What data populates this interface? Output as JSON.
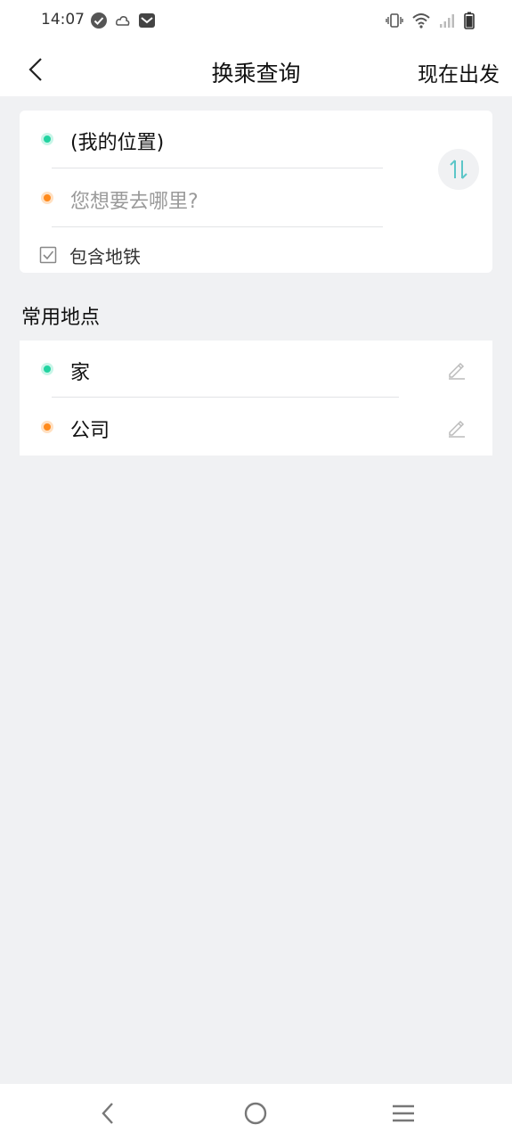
{
  "status_bar": {
    "time": "14:07",
    "left_icons": [
      "check-circle-icon",
      "cloud-icon",
      "mail-icon"
    ],
    "right_icons": [
      "vibrate-icon",
      "wifi-icon",
      "signal-icon",
      "battery-icon"
    ]
  },
  "header": {
    "title": "换乘查询",
    "action_label": "现在出发"
  },
  "route": {
    "origin": "(我的位置)",
    "destination_placeholder": "您想要去哪里?",
    "include_subway_label": "包含地铁",
    "include_subway_checked": true
  },
  "favorites": {
    "title": "常用地点",
    "items": [
      {
        "label": "家",
        "dot_color": "#22d3a0"
      },
      {
        "label": "公司",
        "dot_color": "#ff8a1c"
      }
    ]
  },
  "colors": {
    "accent_green": "#22d3a0",
    "accent_orange": "#ff8a1c",
    "swap_icon": "#5cc6c8",
    "background": "#f0f1f3"
  }
}
